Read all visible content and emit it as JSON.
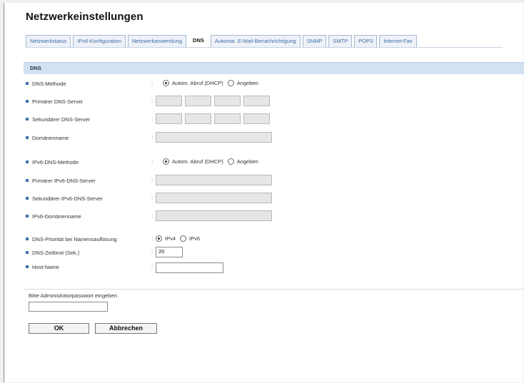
{
  "page": {
    "title": "Netzwerkeinstellungen"
  },
  "tabs": [
    {
      "label": "Netzwerkstatus",
      "active": false
    },
    {
      "label": "IPv6-Konfiguration",
      "active": false
    },
    {
      "label": "Netzwerkanwendung",
      "active": false
    },
    {
      "label": "DNS",
      "active": true
    },
    {
      "label": "Automat. E-Mail-Benachrichtigung",
      "active": false
    },
    {
      "label": "SNMP",
      "active": false
    },
    {
      "label": "SMTP",
      "active": false
    },
    {
      "label": "POP3",
      "active": false
    },
    {
      "label": "Internet-Fax",
      "active": false
    }
  ],
  "section": {
    "title": "DNS"
  },
  "form": {
    "colon": ":",
    "dns_method": {
      "label": "DNS-Methode",
      "option_auto": "Autom. Abruf (DHCP)",
      "option_manual": "Angeben",
      "selected": "auto"
    },
    "primary_dns": {
      "label": "Primärer DNS-Server",
      "octets": [
        "",
        "",
        "",
        ""
      ]
    },
    "secondary_dns": {
      "label": "Sekundärer DNS-Server",
      "octets": [
        "",
        "",
        "",
        ""
      ]
    },
    "domain_name": {
      "label": "Domänenname",
      "value": ""
    },
    "ipv6_dns_method": {
      "label": "IPv6-DNS-Methode",
      "option_auto": "Autom. Abruf (DHCP)",
      "option_manual": "Angeben",
      "selected": "auto"
    },
    "primary_ipv6_dns": {
      "label": "Primärer IPv6-DNS-Server",
      "value": ""
    },
    "secondary_ipv6_dns": {
      "label": "Sekundärer IPv6-DNS-Server",
      "value": ""
    },
    "ipv6_domain_name": {
      "label": "IPv6-Domänenname",
      "value": ""
    },
    "dns_priority": {
      "label": "DNS-Priorität bei Namensauflösung",
      "option_ipv4": "IPv4",
      "option_ipv6": "IPv6",
      "selected": "ipv4"
    },
    "dns_timeout": {
      "label": "DNS-Zeitlimit (Sek.)",
      "value": "20"
    },
    "host_name": {
      "label": "Host-Name",
      "value": ""
    }
  },
  "auth": {
    "prompt": "Bitte Administratorpasswort eingeben.",
    "password": ""
  },
  "buttons": {
    "ok": "OK",
    "cancel": "Abbrechen"
  },
  "colors": {
    "tab_text": "#3f6ea5",
    "section_bar": "#d3e1f3",
    "bullet": "#3c6fb0",
    "disabled_field": "#e6e6e6"
  }
}
